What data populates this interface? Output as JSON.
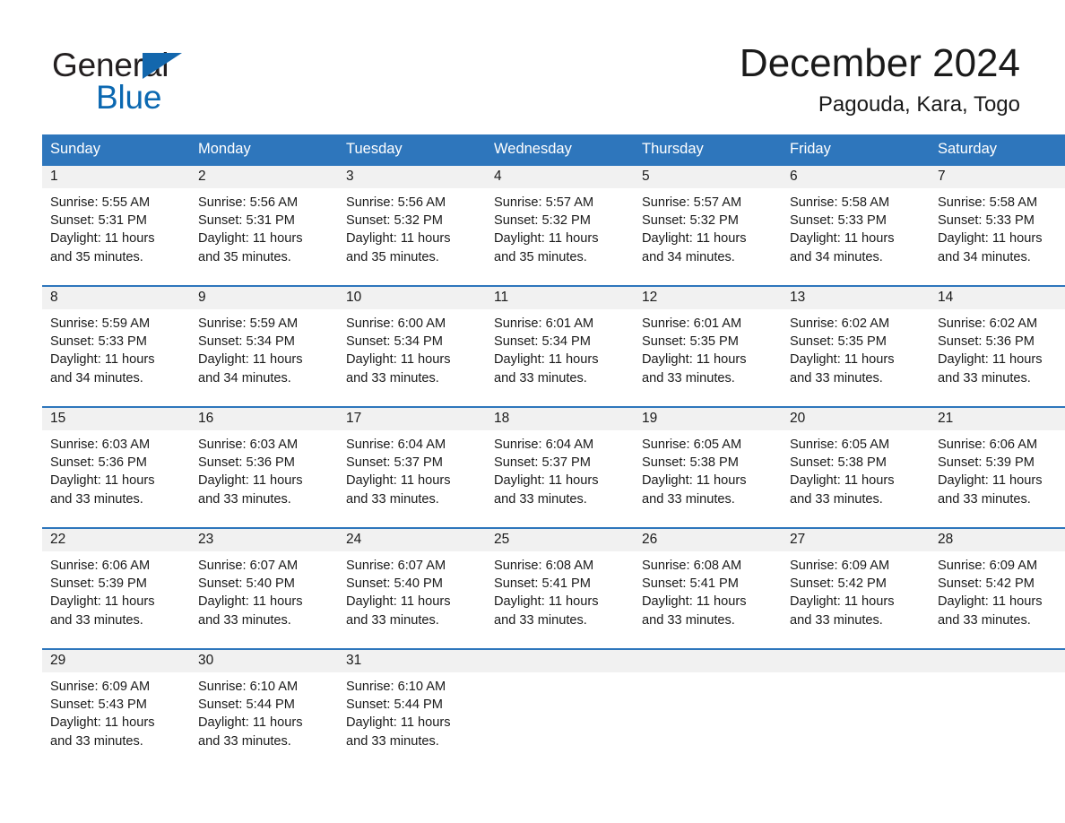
{
  "brand": {
    "word_general": "General",
    "word_blue": "Blue",
    "triangle_color": "#1367ad",
    "blue_text_color": "#0b68b1"
  },
  "header": {
    "title": "December 2024",
    "subtitle": "Pagouda, Kara, Togo"
  },
  "theme": {
    "header_blue": "#2e76bc",
    "daynum_band": "#f1f1f1",
    "row_divider": "#2e76bc",
    "text": "#1a1a1a",
    "page_background": "#ffffff"
  },
  "calendar": {
    "weekday_headers": [
      "Sunday",
      "Monday",
      "Tuesday",
      "Wednesday",
      "Thursday",
      "Friday",
      "Saturday"
    ],
    "weeks": [
      [
        {
          "day": "1",
          "sunrise": "Sunrise: 5:55 AM",
          "sunset": "Sunset: 5:31 PM",
          "daylight_line1": "Daylight: 11 hours",
          "daylight_line2": "and 35 minutes."
        },
        {
          "day": "2",
          "sunrise": "Sunrise: 5:56 AM",
          "sunset": "Sunset: 5:31 PM",
          "daylight_line1": "Daylight: 11 hours",
          "daylight_line2": "and 35 minutes."
        },
        {
          "day": "3",
          "sunrise": "Sunrise: 5:56 AM",
          "sunset": "Sunset: 5:32 PM",
          "daylight_line1": "Daylight: 11 hours",
          "daylight_line2": "and 35 minutes."
        },
        {
          "day": "4",
          "sunrise": "Sunrise: 5:57 AM",
          "sunset": "Sunset: 5:32 PM",
          "daylight_line1": "Daylight: 11 hours",
          "daylight_line2": "and 35 minutes."
        },
        {
          "day": "5",
          "sunrise": "Sunrise: 5:57 AM",
          "sunset": "Sunset: 5:32 PM",
          "daylight_line1": "Daylight: 11 hours",
          "daylight_line2": "and 34 minutes."
        },
        {
          "day": "6",
          "sunrise": "Sunrise: 5:58 AM",
          "sunset": "Sunset: 5:33 PM",
          "daylight_line1": "Daylight: 11 hours",
          "daylight_line2": "and 34 minutes."
        },
        {
          "day": "7",
          "sunrise": "Sunrise: 5:58 AM",
          "sunset": "Sunset: 5:33 PM",
          "daylight_line1": "Daylight: 11 hours",
          "daylight_line2": "and 34 minutes."
        }
      ],
      [
        {
          "day": "8",
          "sunrise": "Sunrise: 5:59 AM",
          "sunset": "Sunset: 5:33 PM",
          "daylight_line1": "Daylight: 11 hours",
          "daylight_line2": "and 34 minutes."
        },
        {
          "day": "9",
          "sunrise": "Sunrise: 5:59 AM",
          "sunset": "Sunset: 5:34 PM",
          "daylight_line1": "Daylight: 11 hours",
          "daylight_line2": "and 34 minutes."
        },
        {
          "day": "10",
          "sunrise": "Sunrise: 6:00 AM",
          "sunset": "Sunset: 5:34 PM",
          "daylight_line1": "Daylight: 11 hours",
          "daylight_line2": "and 33 minutes."
        },
        {
          "day": "11",
          "sunrise": "Sunrise: 6:01 AM",
          "sunset": "Sunset: 5:34 PM",
          "daylight_line1": "Daylight: 11 hours",
          "daylight_line2": "and 33 minutes."
        },
        {
          "day": "12",
          "sunrise": "Sunrise: 6:01 AM",
          "sunset": "Sunset: 5:35 PM",
          "daylight_line1": "Daylight: 11 hours",
          "daylight_line2": "and 33 minutes."
        },
        {
          "day": "13",
          "sunrise": "Sunrise: 6:02 AM",
          "sunset": "Sunset: 5:35 PM",
          "daylight_line1": "Daylight: 11 hours",
          "daylight_line2": "and 33 minutes."
        },
        {
          "day": "14",
          "sunrise": "Sunrise: 6:02 AM",
          "sunset": "Sunset: 5:36 PM",
          "daylight_line1": "Daylight: 11 hours",
          "daylight_line2": "and 33 minutes."
        }
      ],
      [
        {
          "day": "15",
          "sunrise": "Sunrise: 6:03 AM",
          "sunset": "Sunset: 5:36 PM",
          "daylight_line1": "Daylight: 11 hours",
          "daylight_line2": "and 33 minutes."
        },
        {
          "day": "16",
          "sunrise": "Sunrise: 6:03 AM",
          "sunset": "Sunset: 5:36 PM",
          "daylight_line1": "Daylight: 11 hours",
          "daylight_line2": "and 33 minutes."
        },
        {
          "day": "17",
          "sunrise": "Sunrise: 6:04 AM",
          "sunset": "Sunset: 5:37 PM",
          "daylight_line1": "Daylight: 11 hours",
          "daylight_line2": "and 33 minutes."
        },
        {
          "day": "18",
          "sunrise": "Sunrise: 6:04 AM",
          "sunset": "Sunset: 5:37 PM",
          "daylight_line1": "Daylight: 11 hours",
          "daylight_line2": "and 33 minutes."
        },
        {
          "day": "19",
          "sunrise": "Sunrise: 6:05 AM",
          "sunset": "Sunset: 5:38 PM",
          "daylight_line1": "Daylight: 11 hours",
          "daylight_line2": "and 33 minutes."
        },
        {
          "day": "20",
          "sunrise": "Sunrise: 6:05 AM",
          "sunset": "Sunset: 5:38 PM",
          "daylight_line1": "Daylight: 11 hours",
          "daylight_line2": "and 33 minutes."
        },
        {
          "day": "21",
          "sunrise": "Sunrise: 6:06 AM",
          "sunset": "Sunset: 5:39 PM",
          "daylight_line1": "Daylight: 11 hours",
          "daylight_line2": "and 33 minutes."
        }
      ],
      [
        {
          "day": "22",
          "sunrise": "Sunrise: 6:06 AM",
          "sunset": "Sunset: 5:39 PM",
          "daylight_line1": "Daylight: 11 hours",
          "daylight_line2": "and 33 minutes."
        },
        {
          "day": "23",
          "sunrise": "Sunrise: 6:07 AM",
          "sunset": "Sunset: 5:40 PM",
          "daylight_line1": "Daylight: 11 hours",
          "daylight_line2": "and 33 minutes."
        },
        {
          "day": "24",
          "sunrise": "Sunrise: 6:07 AM",
          "sunset": "Sunset: 5:40 PM",
          "daylight_line1": "Daylight: 11 hours",
          "daylight_line2": "and 33 minutes."
        },
        {
          "day": "25",
          "sunrise": "Sunrise: 6:08 AM",
          "sunset": "Sunset: 5:41 PM",
          "daylight_line1": "Daylight: 11 hours",
          "daylight_line2": "and 33 minutes."
        },
        {
          "day": "26",
          "sunrise": "Sunrise: 6:08 AM",
          "sunset": "Sunset: 5:41 PM",
          "daylight_line1": "Daylight: 11 hours",
          "daylight_line2": "and 33 minutes."
        },
        {
          "day": "27",
          "sunrise": "Sunrise: 6:09 AM",
          "sunset": "Sunset: 5:42 PM",
          "daylight_line1": "Daylight: 11 hours",
          "daylight_line2": "and 33 minutes."
        },
        {
          "day": "28",
          "sunrise": "Sunrise: 6:09 AM",
          "sunset": "Sunset: 5:42 PM",
          "daylight_line1": "Daylight: 11 hours",
          "daylight_line2": "and 33 minutes."
        }
      ],
      [
        {
          "day": "29",
          "sunrise": "Sunrise: 6:09 AM",
          "sunset": "Sunset: 5:43 PM",
          "daylight_line1": "Daylight: 11 hours",
          "daylight_line2": "and 33 minutes."
        },
        {
          "day": "30",
          "sunrise": "Sunrise: 6:10 AM",
          "sunset": "Sunset: 5:44 PM",
          "daylight_line1": "Daylight: 11 hours",
          "daylight_line2": "and 33 minutes."
        },
        {
          "day": "31",
          "sunrise": "Sunrise: 6:10 AM",
          "sunset": "Sunset: 5:44 PM",
          "daylight_line1": "Daylight: 11 hours",
          "daylight_line2": "and 33 minutes."
        },
        {
          "day": "",
          "sunrise": "",
          "sunset": "",
          "daylight_line1": "",
          "daylight_line2": ""
        },
        {
          "day": "",
          "sunrise": "",
          "sunset": "",
          "daylight_line1": "",
          "daylight_line2": ""
        },
        {
          "day": "",
          "sunrise": "",
          "sunset": "",
          "daylight_line1": "",
          "daylight_line2": ""
        },
        {
          "day": "",
          "sunrise": "",
          "sunset": "",
          "daylight_line1": "",
          "daylight_line2": ""
        }
      ]
    ]
  }
}
